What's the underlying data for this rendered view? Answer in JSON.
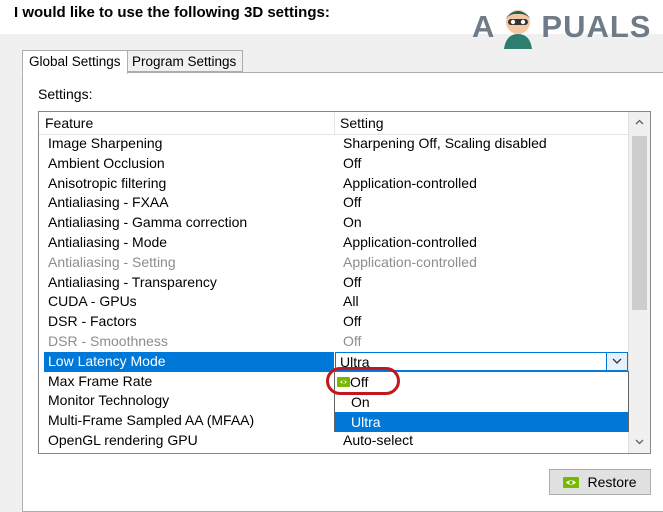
{
  "header": {
    "title": "I would like to use the following 3D settings:"
  },
  "watermark": {
    "left": "A",
    "right": "PUALS"
  },
  "tabs": [
    {
      "label": "Global Settings",
      "active": true
    },
    {
      "label": "Program Settings",
      "active": false
    }
  ],
  "settings_label": "Settings:",
  "grid": {
    "columns": {
      "feature": "Feature",
      "setting": "Setting"
    },
    "rows": [
      {
        "feature": "Image Sharpening",
        "setting": "Sharpening Off, Scaling disabled",
        "state": "normal"
      },
      {
        "feature": "Ambient Occlusion",
        "setting": "Off",
        "state": "normal"
      },
      {
        "feature": "Anisotropic filtering",
        "setting": "Application-controlled",
        "state": "normal"
      },
      {
        "feature": "Antialiasing - FXAA",
        "setting": "Off",
        "state": "normal"
      },
      {
        "feature": "Antialiasing - Gamma correction",
        "setting": "On",
        "state": "normal"
      },
      {
        "feature": "Antialiasing - Mode",
        "setting": "Application-controlled",
        "state": "normal"
      },
      {
        "feature": "Antialiasing - Setting",
        "setting": "Application-controlled",
        "state": "disabled"
      },
      {
        "feature": "Antialiasing - Transparency",
        "setting": "Off",
        "state": "normal"
      },
      {
        "feature": "CUDA - GPUs",
        "setting": "All",
        "state": "normal"
      },
      {
        "feature": "DSR - Factors",
        "setting": "Off",
        "state": "normal"
      },
      {
        "feature": "DSR - Smoothness",
        "setting": "Off",
        "state": "disabled"
      },
      {
        "feature": "Low Latency Mode",
        "setting": "Ultra",
        "state": "selected"
      },
      {
        "feature": "Max Frame Rate",
        "setting": "",
        "state": "normal"
      },
      {
        "feature": "Monitor Technology",
        "setting": "",
        "state": "normal"
      },
      {
        "feature": "Multi-Frame Sampled AA (MFAA)",
        "setting": "",
        "state": "normal"
      },
      {
        "feature": "OpenGL rendering GPU",
        "setting": "Auto-select",
        "state": "normal"
      }
    ]
  },
  "dropdown": {
    "options": [
      {
        "label": "Off",
        "nvidia_default": true
      },
      {
        "label": "On"
      },
      {
        "label": "Ultra"
      }
    ],
    "selected": "Ultra"
  },
  "restore_button": {
    "label": "Restore"
  },
  "colors": {
    "selection": "#0078d7",
    "annotation": "#c4161c",
    "nvidia_green": "#76b900"
  },
  "icons": [
    "scroll-up-arrow-icon",
    "scroll-down-arrow-icon",
    "chevron-down-icon",
    "nvidia-logo-icon"
  ]
}
